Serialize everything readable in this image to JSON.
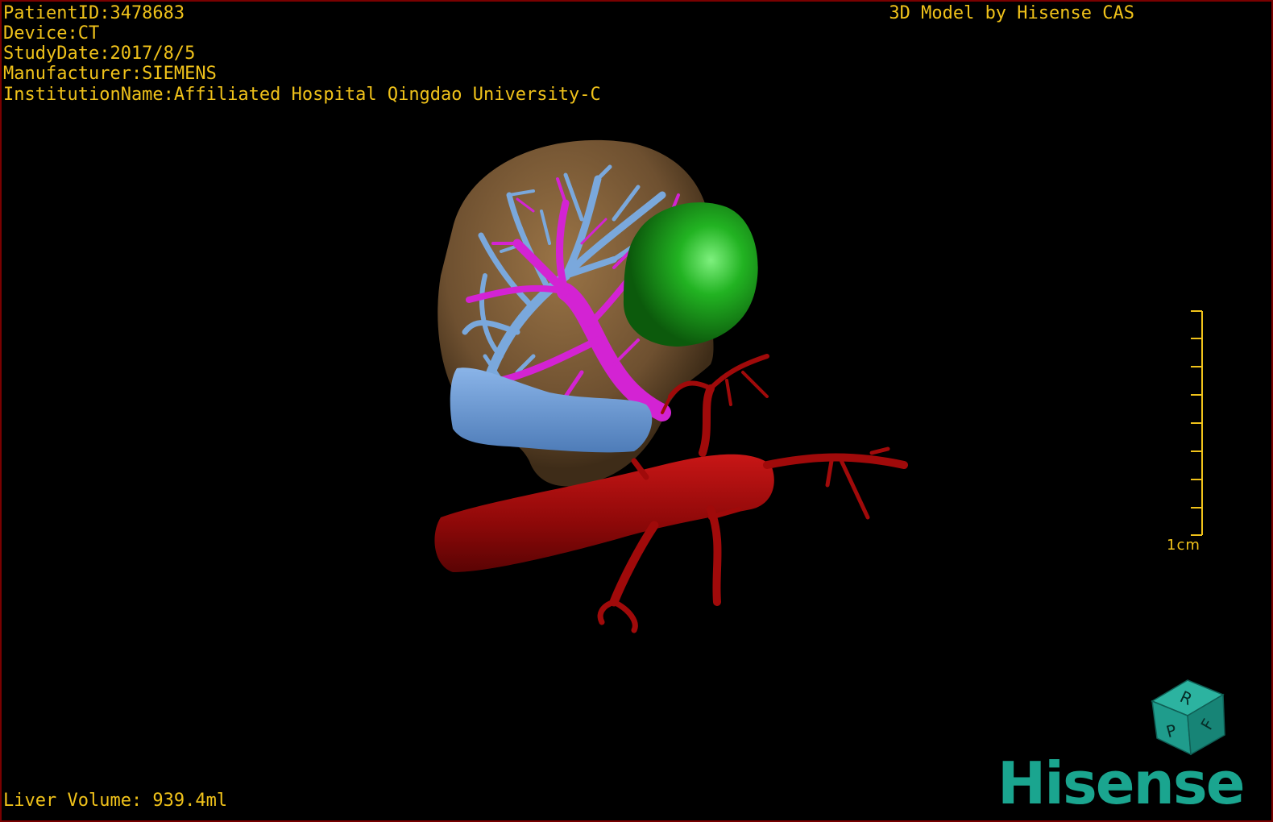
{
  "header": {
    "patient_id": "PatientID:3478683",
    "device": "Device:CT",
    "study_date": "StudyDate:2017/8/5",
    "manufacturer": "Manufacturer:SIEMENS",
    "institution": "InstitutionName:Affiliated Hospital Qingdao University-C",
    "title": "3D Model by Hisense CAS"
  },
  "footer": {
    "liver_volume": "Liver Volume: 939.4ml"
  },
  "scale": {
    "label": "1cm"
  },
  "orientation_cube": {
    "labels": [
      "R",
      "F",
      "P"
    ],
    "color": "#1f9c8c"
  },
  "brand": {
    "logo_text": "Hisense",
    "color": "#1aa58f"
  },
  "colors": {
    "text": "#f0c21a",
    "liver": "#7a5a33",
    "tumor": "#1e8f1e",
    "portal_vein": "#d020d0",
    "hepatic_vein": "#6f9fd8",
    "artery": "#a00a0a"
  }
}
